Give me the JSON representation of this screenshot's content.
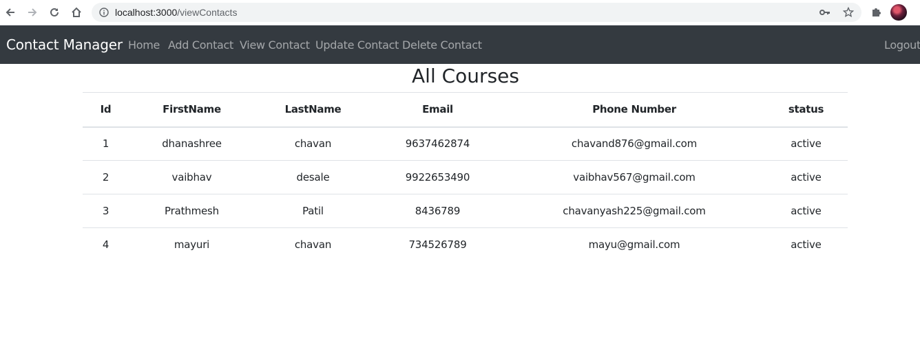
{
  "browser": {
    "url_host": "localhost:3000",
    "url_path": "/viewContacts"
  },
  "navbar": {
    "brand": "Contact Manager",
    "links": [
      "Home",
      "Add Contact",
      "View Contact",
      "Update Contact",
      "Delete Contact"
    ],
    "logout": "Logout",
    "bg_color": "#343a40"
  },
  "page": {
    "title": "All Courses"
  },
  "table": {
    "headers": [
      "Id",
      "FirstName",
      "LastName",
      "Email",
      "Phone Number",
      "status"
    ],
    "rows": [
      [
        "1",
        "dhanashree",
        "chavan",
        "9637462874",
        "chavand876@gmail.com",
        "active"
      ],
      [
        "2",
        "vaibhav",
        "desale",
        "9922653490",
        "vaibhav567@gmail.com",
        "active"
      ],
      [
        "3",
        "Prathmesh",
        "Patil",
        "8436789",
        "chavanyash225@gmail.com",
        "active"
      ],
      [
        "4",
        "mayuri",
        "chavan",
        "734526789",
        "mayu@gmail.com",
        "active"
      ]
    ]
  }
}
